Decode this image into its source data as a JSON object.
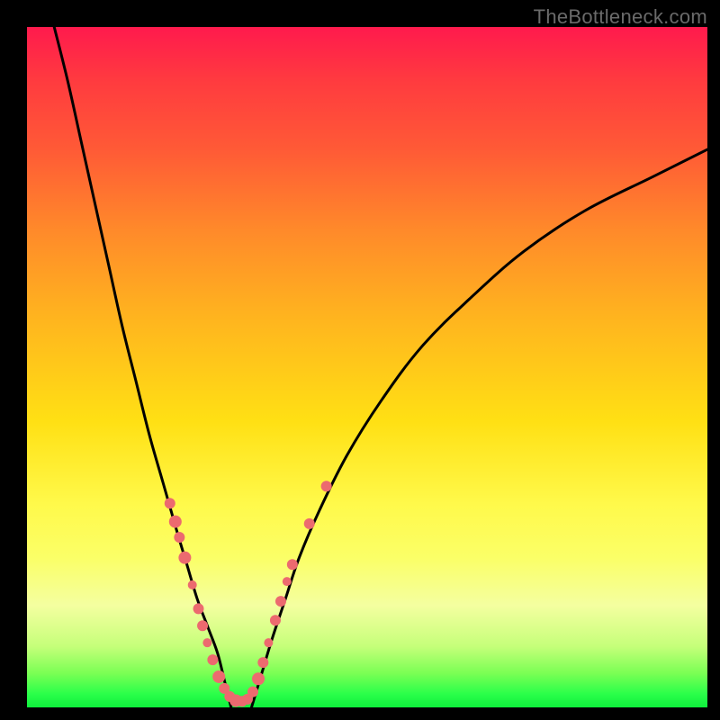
{
  "watermark": "TheBottleneck.com",
  "chart_data": {
    "type": "line",
    "title": "",
    "xlabel": "",
    "ylabel": "",
    "xlim": [
      0,
      100
    ],
    "ylim": [
      0,
      100
    ],
    "series": [
      {
        "name": "left-curve",
        "x": [
          4,
          6,
          8,
          10,
          12,
          14,
          16,
          18,
          20,
          22,
          23.5,
          25,
          26.5,
          28,
          29,
          30
        ],
        "y": [
          100,
          92,
          83,
          74,
          65,
          56,
          48,
          40,
          33,
          26,
          21,
          16,
          12,
          8,
          4,
          0
        ]
      },
      {
        "name": "right-curve",
        "x": [
          33,
          34.5,
          36,
          38,
          40,
          43,
          47,
          52,
          58,
          65,
          73,
          82,
          92,
          100
        ],
        "y": [
          0,
          5,
          10,
          16,
          22,
          29,
          37,
          45,
          53,
          60,
          67,
          73,
          78,
          82
        ]
      }
    ],
    "scatter": {
      "name": "highlight-points",
      "color": "#ec6a6f",
      "points": [
        {
          "x": 21.0,
          "y": 30.0,
          "r": 6
        },
        {
          "x": 21.8,
          "y": 27.3,
          "r": 7
        },
        {
          "x": 22.4,
          "y": 25.0,
          "r": 6
        },
        {
          "x": 23.2,
          "y": 22.0,
          "r": 7
        },
        {
          "x": 24.3,
          "y": 18.0,
          "r": 5
        },
        {
          "x": 25.2,
          "y": 14.5,
          "r": 6
        },
        {
          "x": 25.8,
          "y": 12.0,
          "r": 6
        },
        {
          "x": 26.5,
          "y": 9.5,
          "r": 5
        },
        {
          "x": 27.3,
          "y": 7.0,
          "r": 6
        },
        {
          "x": 28.2,
          "y": 4.5,
          "r": 7
        },
        {
          "x": 29.0,
          "y": 2.8,
          "r": 6
        },
        {
          "x": 29.8,
          "y": 1.6,
          "r": 6
        },
        {
          "x": 30.7,
          "y": 1.0,
          "r": 7
        },
        {
          "x": 31.6,
          "y": 0.9,
          "r": 6
        },
        {
          "x": 32.4,
          "y": 1.2,
          "r": 6
        },
        {
          "x": 33.2,
          "y": 2.3,
          "r": 6
        },
        {
          "x": 34.0,
          "y": 4.2,
          "r": 7
        },
        {
          "x": 34.7,
          "y": 6.6,
          "r": 6
        },
        {
          "x": 35.5,
          "y": 9.5,
          "r": 5
        },
        {
          "x": 36.5,
          "y": 12.8,
          "r": 6
        },
        {
          "x": 37.3,
          "y": 15.6,
          "r": 6
        },
        {
          "x": 38.2,
          "y": 18.5,
          "r": 5
        },
        {
          "x": 39.0,
          "y": 21.0,
          "r": 6
        },
        {
          "x": 41.5,
          "y": 27.0,
          "r": 6
        },
        {
          "x": 44.0,
          "y": 32.5,
          "r": 6
        }
      ]
    }
  }
}
